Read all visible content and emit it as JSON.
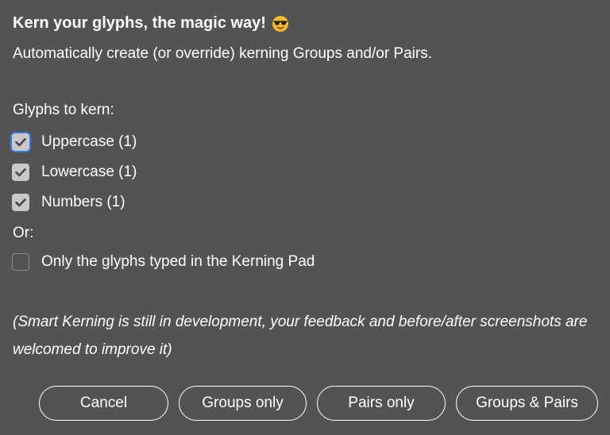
{
  "dialog": {
    "title": "Kern your glyphs, the magic way!",
    "title_emoji": "smiling-face-with-sunglasses",
    "subtitle": "Automatically create (or override) kerning Groups and/or Pairs.",
    "glyphs_label": "Glyphs to kern:",
    "options": [
      {
        "label": "Uppercase (1)",
        "checked": true,
        "focused": true
      },
      {
        "label": "Lowercase (1)",
        "checked": true,
        "focused": false
      },
      {
        "label": "Numbers (1)",
        "checked": true,
        "focused": false
      }
    ],
    "or_label": "Or:",
    "kerning_pad_option": {
      "label": "Only the glyphs typed in the Kerning Pad",
      "checked": false
    },
    "note": "(Smart Kerning is still in development, your feedback and before/after screenshots are welcomed to improve it)",
    "buttons": {
      "cancel": "Cancel",
      "groups_only": "Groups only",
      "pairs_only": "Pairs only",
      "groups_and_pairs": "Groups & Pairs"
    }
  },
  "colors": {
    "background": "#535353",
    "text": "#ffffff",
    "checkbox_fill": "#c8c8c8",
    "checkmark": "#4a4a4a",
    "focus_ring": "#3a7bd5",
    "emoji_face": "#f5b82e"
  }
}
